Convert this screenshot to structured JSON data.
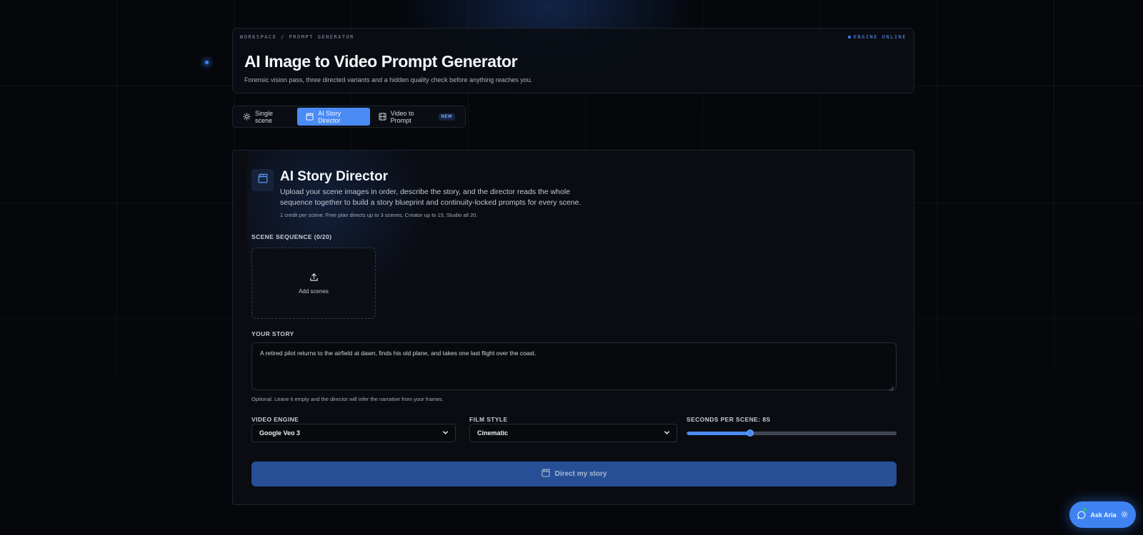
{
  "header": {
    "breadcrumb": "WORKSPACE / PROMPT GENERATOR",
    "status": "ENGINE ONLINE",
    "title": "AI Image to Video Prompt Generator",
    "subtitle": "Forensic vision pass, three directed variants and a hidden quality check before anything reaches you."
  },
  "tabs": [
    {
      "label": "Single scene",
      "icon": "sparkle-icon",
      "active": false
    },
    {
      "label": "AI Story Director",
      "icon": "clapperboard-icon",
      "active": true
    },
    {
      "label": "Video to Prompt",
      "icon": "film-icon",
      "active": false,
      "badge": "NEW"
    }
  ],
  "director": {
    "icon": "clapperboard-icon",
    "title": "AI Story Director",
    "description": "Upload your scene images in order, describe the story, and the director reads the whole sequence together to build a story blueprint and continuity-locked prompts for every scene.",
    "credit_note": "1 credit per scene. Free plan directs up to 3 scenes, Creator up to 15, Studio all 20."
  },
  "scenes": {
    "label": "SCENE SEQUENCE (0/20)",
    "add_label": "Add scenes",
    "add_icon": "upload-icon"
  },
  "story": {
    "label": "YOUR STORY",
    "value": "A retired pilot returns to the airfield at dawn, finds his old plane, and takes one last flight over the coast.",
    "hint": "Optional. Leave it empty and the director will infer the narrative from your frames."
  },
  "video_engine": {
    "label": "VIDEO ENGINE",
    "value": "Google Veo 3"
  },
  "film_style": {
    "label": "FILM STYLE",
    "value": "Cinematic"
  },
  "seconds": {
    "label": "SECONDS PER SCENE: 8S",
    "value": 8,
    "min": 2,
    "max": 20,
    "fraction": 0.3
  },
  "submit": {
    "label": "Direct my story",
    "icon": "clapperboard-icon"
  },
  "chat": {
    "label": "Ask Aria",
    "icon": "chat-bubble-icon",
    "trailing_icon": "sparkle-icon"
  },
  "colors": {
    "accent": "#4a8bf5",
    "background": "#05070b",
    "card": "#0a0d13",
    "status_online": "#22c55e"
  }
}
